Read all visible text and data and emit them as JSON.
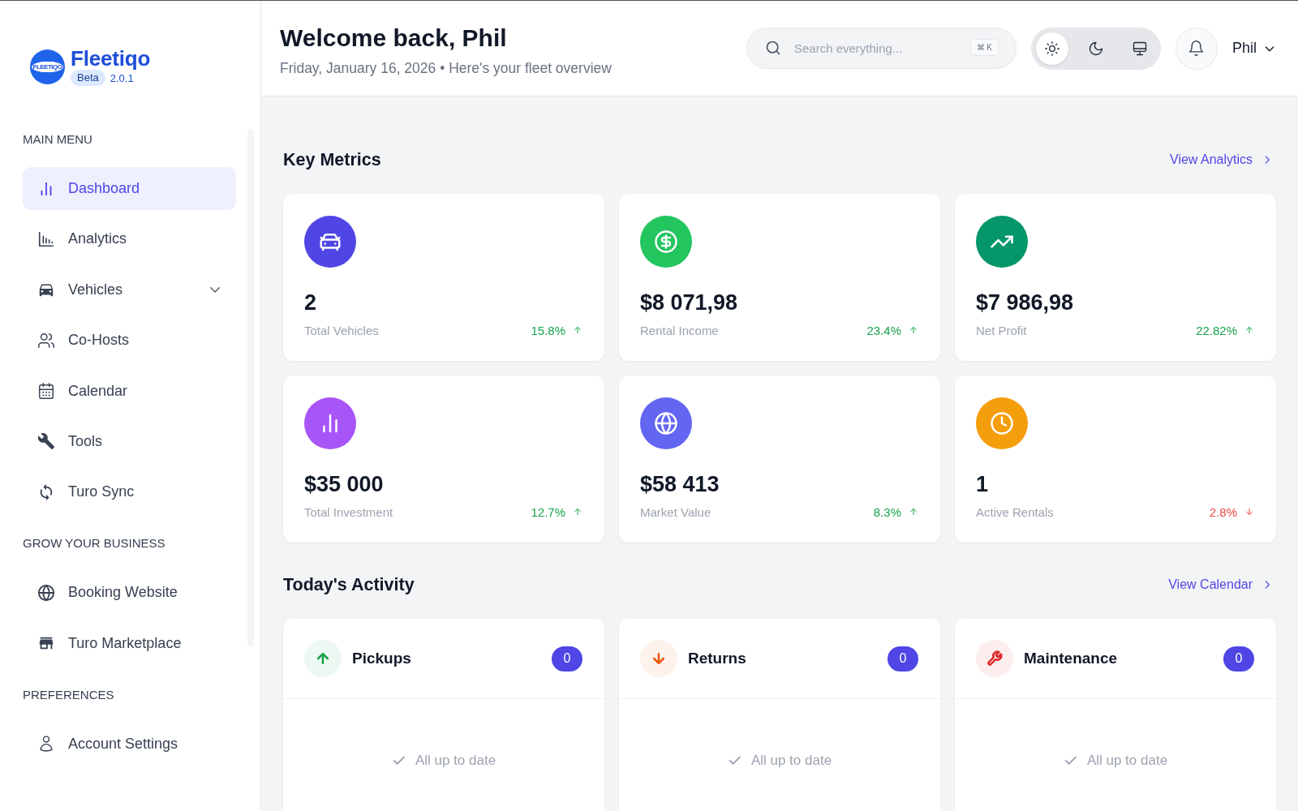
{
  "sidebar": {
    "brand": {
      "logo_text": "FLEETIQO",
      "name": "Fleetiqo",
      "badge": "Beta",
      "version": "2.0.1"
    },
    "sections": [
      {
        "title": "MAIN MENU",
        "items": [
          {
            "label": "Dashboard",
            "kind": "link",
            "selected": true
          },
          {
            "label": "Analytics",
            "kind": "link",
            "selected": false
          },
          {
            "label": "Vehicles",
            "kind": "group",
            "selected": false,
            "expanded": false
          },
          {
            "label": "Co-Hosts",
            "kind": "link",
            "selected": false
          },
          {
            "label": "Calendar",
            "kind": "link",
            "selected": false
          },
          {
            "label": "Tools",
            "kind": "link",
            "selected": false
          },
          {
            "label": "Turo Sync",
            "kind": "link",
            "selected": false
          }
        ]
      },
      {
        "title": "GROW YOUR BUSINESS",
        "items": [
          {
            "label": "Booking Website",
            "kind": "link",
            "selected": false
          },
          {
            "label": "Turo Marketplace",
            "kind": "link",
            "selected": false
          }
        ]
      },
      {
        "title": "PREFERENCES",
        "items": [
          {
            "label": "Account Settings",
            "kind": "link",
            "selected": false
          }
        ]
      }
    ]
  },
  "header": {
    "title": "Welcome back, Phil",
    "subtitle": "Friday, January 16, 2026 • Here's your fleet overview",
    "search": {
      "placeholder": "Search everything...",
      "shortcut": "⌘ K"
    },
    "theme_options": [
      {
        "kind": "light",
        "selected": true
      },
      {
        "kind": "dark",
        "selected": false
      },
      {
        "kind": "system",
        "selected": false
      }
    ],
    "user": {
      "name": "Phil"
    }
  },
  "key_metrics": {
    "title": "Key Metrics",
    "link": "View Analytics",
    "cards": [
      {
        "value": "2",
        "label": "Total Vehicles",
        "change": "15.8%",
        "rising": true,
        "color": "#5046e5"
      },
      {
        "value": "$8 071,98",
        "label": "Rental Income",
        "change": "23.4%",
        "rising": true,
        "color": "#22c55e"
      },
      {
        "value": "$7 986,98",
        "label": "Net Profit",
        "change": "22.82%",
        "rising": true,
        "color": "#059669"
      },
      {
        "value": "$35 000",
        "label": "Total Investment",
        "change": "12.7%",
        "rising": true,
        "color": "#a855f7"
      },
      {
        "value": "$58 413",
        "label": "Market Value",
        "change": "8.3%",
        "rising": true,
        "color": "#6366f1"
      },
      {
        "value": "1",
        "label": "Active Rentals",
        "change": "2.8%",
        "rising": false,
        "color": "#f59e0b"
      }
    ]
  },
  "todays_activity": {
    "title": "Today's Activity",
    "link": "View Calendar",
    "cards": [
      {
        "title": "Pickups",
        "count": "0",
        "empty_text": "All up to date",
        "color": "#16a34a"
      },
      {
        "title": "Returns",
        "count": "0",
        "empty_text": "All up to date",
        "color": "#ea580c"
      },
      {
        "title": "Maintenance",
        "count": "0",
        "empty_text": "All up to date",
        "color": "#dc2626"
      }
    ]
  }
}
